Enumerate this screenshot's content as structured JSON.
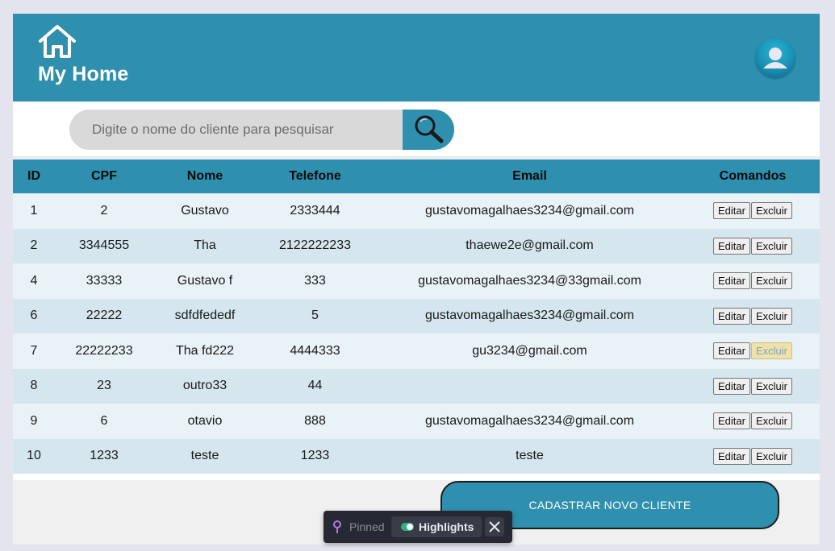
{
  "header": {
    "brand": "My Home",
    "home_icon": "home-icon",
    "avatar_icon": "user-avatar-icon"
  },
  "search": {
    "placeholder": "Digite o nome do cliente para pesquisar",
    "button_icon": "magnifier-icon"
  },
  "table": {
    "columns": [
      "ID",
      "CPF",
      "Nome",
      "Telefone",
      "Email",
      "Comandos"
    ],
    "rows": [
      {
        "id": "1",
        "cpf": "2",
        "nome": "Gustavo",
        "telefone": "2333444",
        "email": "gustavomagalhaes3234@gmail.com"
      },
      {
        "id": "2",
        "cpf": "3344555",
        "nome": "Tha",
        "telefone": "2122222233",
        "email": "thaewe2e@gmail.com"
      },
      {
        "id": "4",
        "cpf": "33333",
        "nome": "Gustavo f",
        "telefone": "333",
        "email": "gustavomagalhaes3234@33gmail.com"
      },
      {
        "id": "6",
        "cpf": "22222",
        "nome": "sdfdfededf",
        "telefone": "5",
        "email": "gustavomagalhaes3234@gmail.com"
      },
      {
        "id": "7",
        "cpf": "22222233",
        "nome": "Tha fd222",
        "telefone": "4444333",
        "email": "gu3234@gmail.com"
      },
      {
        "id": "8",
        "cpf": "23",
        "nome": "outro33",
        "telefone": "44",
        "email": ""
      },
      {
        "id": "9",
        "cpf": "6",
        "nome": "otavio",
        "telefone": "888",
        "email": "gustavomagalhaes3234@gmail.com"
      },
      {
        "id": "10",
        "cpf": "1233",
        "nome": "teste",
        "telefone": "1233",
        "email": "teste"
      }
    ],
    "edit_label": "Editar",
    "delete_label": "Excluir",
    "highlighted_delete_row": 4
  },
  "add_button": "CADASTRAR NOVO CLIENTE",
  "pin_toolbar": {
    "pinned_label": "Pinned",
    "highlights_label": "Highlights",
    "highlights_on": true
  },
  "colors": {
    "primary": "#2f8fae",
    "row_light": "#e9f2f6",
    "row_dark": "#d5e6ee",
    "page_bg": "#e3e4ee"
  }
}
